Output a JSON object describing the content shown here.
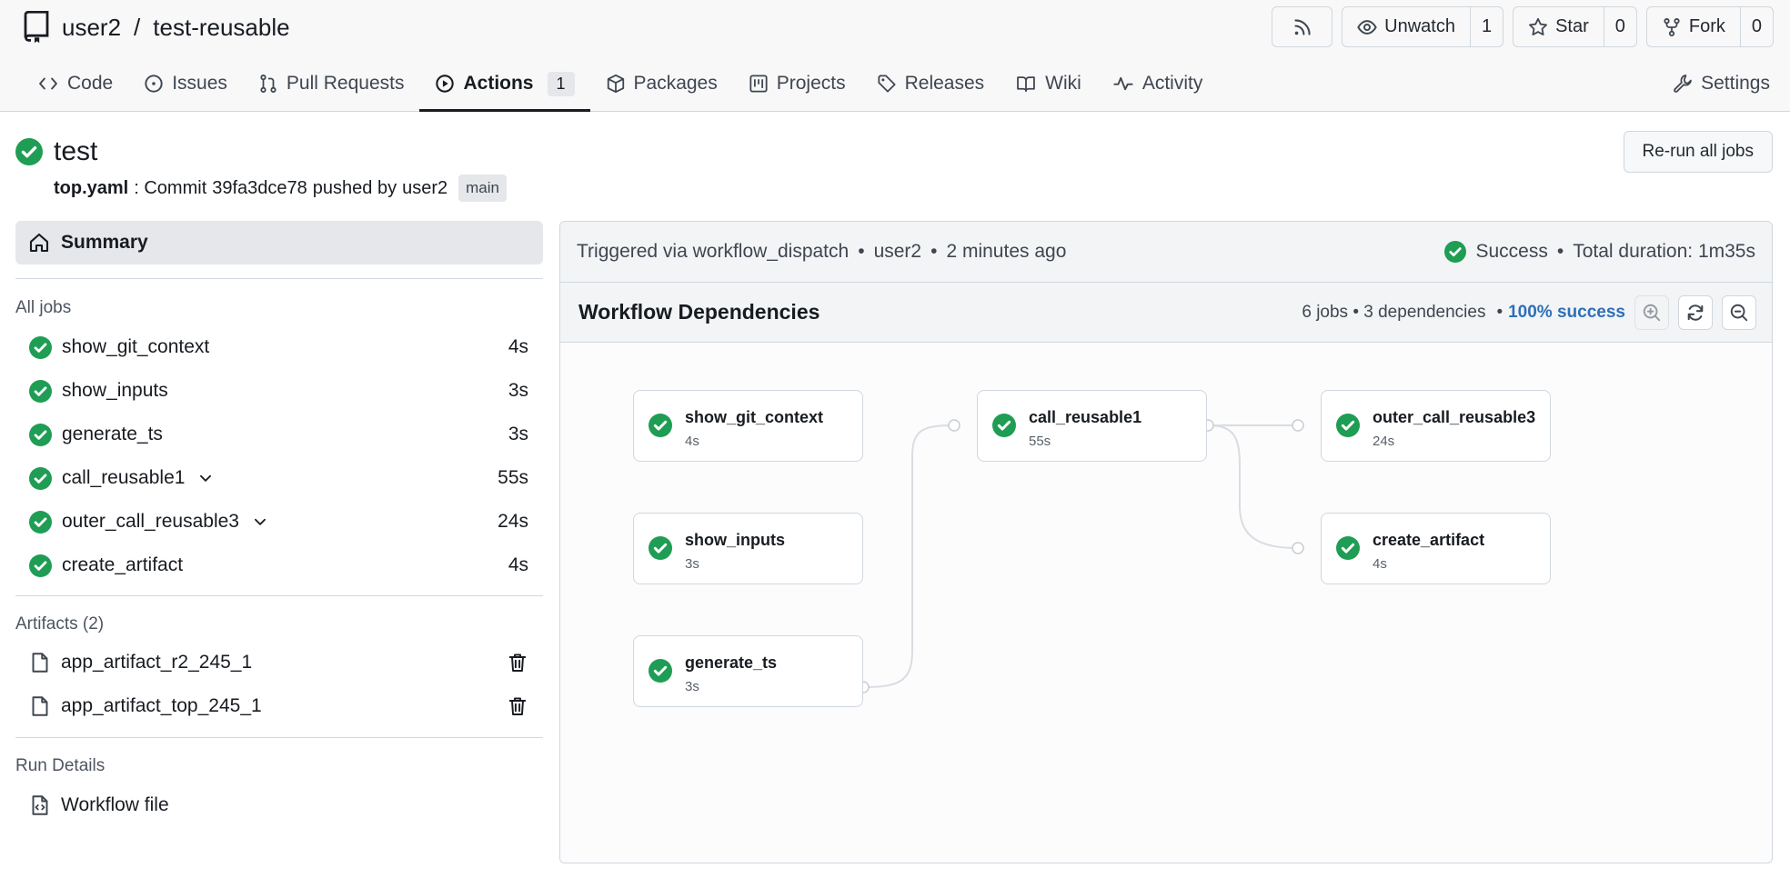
{
  "repo": {
    "owner": "user2",
    "separator": "/",
    "name": "test-reusable"
  },
  "header_buttons": {
    "watch": {
      "label": "Unwatch",
      "count": "1"
    },
    "star": {
      "label": "Star",
      "count": "0"
    },
    "fork": {
      "label": "Fork",
      "count": "0"
    }
  },
  "tabs": {
    "code": "Code",
    "issues": "Issues",
    "pulls": "Pull Requests",
    "actions": "Actions",
    "actions_count": "1",
    "packages": "Packages",
    "projects": "Projects",
    "releases": "Releases",
    "wiki": "Wiki",
    "activity": "Activity",
    "settings": "Settings"
  },
  "run": {
    "title": "test",
    "file": "top.yaml",
    "commit_text": ": Commit",
    "commit_sha": "39fa3dce78",
    "pushed_by": "pushed by",
    "user": "user2",
    "branch": "main",
    "rerun_label": "Re-run all jobs"
  },
  "sidebar": {
    "summary": "Summary",
    "all_jobs_label": "All jobs",
    "jobs": [
      {
        "name": "show_git_context",
        "duration": "4s",
        "expandable": false
      },
      {
        "name": "show_inputs",
        "duration": "3s",
        "expandable": false
      },
      {
        "name": "generate_ts",
        "duration": "3s",
        "expandable": false
      },
      {
        "name": "call_reusable1",
        "duration": "55s",
        "expandable": true
      },
      {
        "name": "outer_call_reusable3",
        "duration": "24s",
        "expandable": true
      },
      {
        "name": "create_artifact",
        "duration": "4s",
        "expandable": false
      }
    ],
    "artifacts_label": "Artifacts (2)",
    "artifacts": [
      {
        "name": "app_artifact_r2_245_1"
      },
      {
        "name": "app_artifact_top_245_1"
      }
    ],
    "run_details_label": "Run Details",
    "workflow_file": "Workflow file"
  },
  "panel": {
    "triggered": "Triggered via workflow_dispatch",
    "dot": "•",
    "user": "user2",
    "ago": "2 minutes ago",
    "status": "Success",
    "total_duration": "Total duration: 1m35s"
  },
  "workflow": {
    "title": "Workflow Dependencies",
    "stats": "6 jobs • 3 dependencies",
    "bullet": "•",
    "success_pct": "100% success",
    "nodes": [
      {
        "name": "show_git_context",
        "duration": "4s"
      },
      {
        "name": "show_inputs",
        "duration": "3s"
      },
      {
        "name": "generate_ts",
        "duration": "3s"
      },
      {
        "name": "call_reusable1",
        "duration": "55s"
      },
      {
        "name": "outer_call_reusable3",
        "duration": "24s"
      },
      {
        "name": "create_artifact",
        "duration": "4s"
      }
    ]
  },
  "colors": {
    "success": "#1f9d55",
    "link": "#2e6fb8",
    "border": "#d0d7de"
  }
}
